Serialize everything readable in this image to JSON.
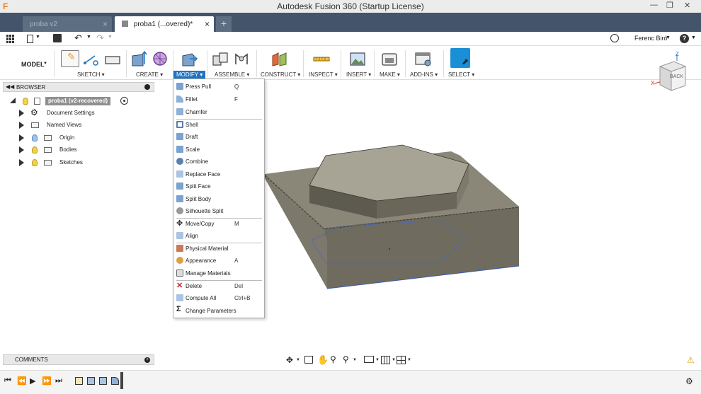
{
  "app": {
    "window_title": "Autodesk Fusion 360 (Startup License)",
    "logo_letter": "F"
  },
  "tabs": [
    {
      "label": "proba v2",
      "active": false
    },
    {
      "label": "proba1 (...overed)*",
      "active": true
    }
  ],
  "user": {
    "name": "Ferenc Biró"
  },
  "workspace": {
    "label": "MODEL"
  },
  "ribbon": {
    "groups": [
      {
        "label": "SKETCH",
        "active": false
      },
      {
        "label": "CREATE",
        "active": false
      },
      {
        "label": "MODIFY",
        "active": true
      },
      {
        "label": "ASSEMBLE",
        "active": false
      },
      {
        "label": "CONSTRUCT",
        "active": false
      },
      {
        "label": "INSPECT",
        "active": false
      },
      {
        "label": "INSERT",
        "active": false
      },
      {
        "label": "MAKE",
        "active": false
      },
      {
        "label": "ADD-INS",
        "active": false
      },
      {
        "label": "SELECT",
        "active": false
      }
    ]
  },
  "browser": {
    "header": "BROWSER",
    "root": "proba1 (v2-recovered)",
    "items": [
      {
        "label": "Document Settings"
      },
      {
        "label": "Named Views"
      },
      {
        "label": "Origin"
      },
      {
        "label": "Bodies"
      },
      {
        "label": "Sketches"
      }
    ]
  },
  "modify_menu": {
    "items": [
      {
        "label": "Press Pull",
        "shortcut": "Q"
      },
      {
        "label": "Fillet",
        "shortcut": "F"
      },
      {
        "label": "Chamfer",
        "shortcut": ""
      },
      {
        "label": "Shell",
        "shortcut": ""
      },
      {
        "label": "Draft",
        "shortcut": ""
      },
      {
        "label": "Scale",
        "shortcut": ""
      },
      {
        "label": "Combine",
        "shortcut": ""
      },
      {
        "label": "Replace Face",
        "shortcut": ""
      },
      {
        "label": "Split Face",
        "shortcut": ""
      },
      {
        "label": "Split Body",
        "shortcut": ""
      },
      {
        "label": "Silhouette Split",
        "shortcut": ""
      },
      {
        "label": "Move/Copy",
        "shortcut": "M"
      },
      {
        "label": "Align",
        "shortcut": ""
      },
      {
        "label": "Physical Material",
        "shortcut": ""
      },
      {
        "label": "Appearance",
        "shortcut": "A"
      },
      {
        "label": "Manage Materials",
        "shortcut": ""
      },
      {
        "label": "Delete",
        "shortcut": "Del"
      },
      {
        "label": "Compute All",
        "shortcut": "Ctrl+B"
      },
      {
        "label": "Change Parameters",
        "shortcut": ""
      }
    ]
  },
  "comments": {
    "header": "COMMENTS"
  },
  "viewcube": {
    "face": "BACK",
    "axis_x": "X",
    "axis_z": "Z"
  },
  "colors": {
    "tab_bar": "#44546a",
    "accent": "#1f75c4",
    "model_side": "#6f6b5e",
    "model_top": "#898577"
  }
}
